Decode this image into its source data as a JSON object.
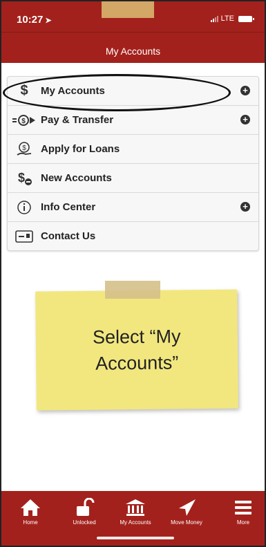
{
  "status_bar": {
    "time": "10:27",
    "carrier": "LTE"
  },
  "nav": {
    "title": "My Accounts"
  },
  "menu": {
    "items": [
      {
        "label": "My Accounts",
        "icon": "dollar-icon"
      },
      {
        "label": "Pay & Transfer",
        "icon": "money-transfer-icon"
      },
      {
        "label": "Apply for Loans",
        "icon": "loan-hand-icon"
      },
      {
        "label": "New Accounts",
        "icon": "new-account-dollar-icon"
      },
      {
        "label": "Info Center",
        "icon": "info-icon"
      },
      {
        "label": "Contact Us",
        "icon": "contact-card-icon"
      }
    ]
  },
  "note": {
    "line1": "Select “My",
    "line2": "Accounts”"
  },
  "tabbar": {
    "tabs": [
      {
        "label": "Home",
        "icon": "home-icon"
      },
      {
        "label": "Unlocked",
        "icon": "unlocked-icon"
      },
      {
        "label": "My Accounts",
        "icon": "bank-icon"
      },
      {
        "label": "Move Money",
        "icon": "send-icon"
      },
      {
        "label": "More",
        "icon": "menu-icon"
      }
    ]
  },
  "colors": {
    "brand": "#a3211c",
    "note": "#f2e77f"
  }
}
